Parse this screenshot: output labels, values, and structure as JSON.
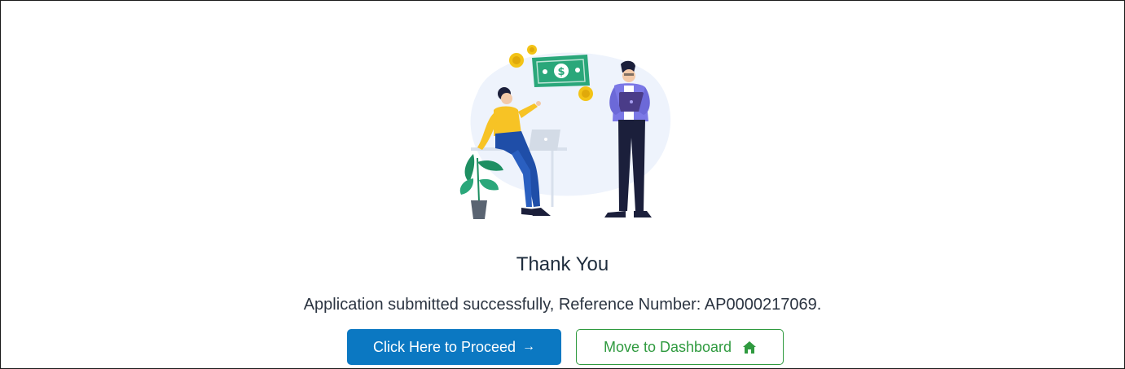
{
  "confirmation": {
    "title": "Thank You",
    "message": "Application submitted successfully, Reference Number: AP0000217069."
  },
  "actions": {
    "proceed_label": "Click Here to Proceed",
    "proceed_icon": "arrow-right-icon",
    "dashboard_label": "Move to Dashboard",
    "dashboard_icon": "home-icon"
  },
  "colors": {
    "primary": "#0b78c2",
    "success": "#2f9a3f",
    "text": "#1f2d3d"
  }
}
